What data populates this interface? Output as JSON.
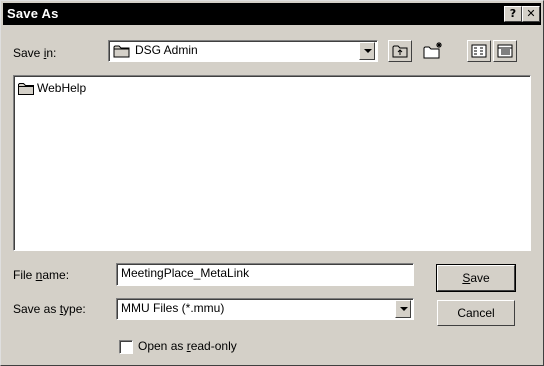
{
  "window": {
    "title": "Save As",
    "help_glyph": "?",
    "close_glyph": "✕"
  },
  "save_in": {
    "label_pre": "Save ",
    "label_hotkey": "i",
    "label_post": "n:",
    "value": "DSG Admin"
  },
  "toolbar": {
    "icons": [
      "up-one-level-icon",
      "create-new-folder-icon",
      "list-view-icon",
      "details-view-icon"
    ]
  },
  "file_list": {
    "items": [
      {
        "name": "WebHelp",
        "icon": "folder-icon"
      }
    ]
  },
  "file_name": {
    "label_pre": "File ",
    "label_hotkey": "n",
    "label_post": "ame:",
    "value": "MeetingPlace_MetaLink"
  },
  "save_as_type": {
    "label_pre": "Save as ",
    "label_hotkey": "t",
    "label_post": "ype:",
    "value": "MMU Files (*.mmu)"
  },
  "read_only": {
    "label_pre": "Open as ",
    "label_hotkey": "r",
    "label_post": "ead-only",
    "checked": false
  },
  "buttons": {
    "save_hotkey": "S",
    "save_rest": "ave",
    "cancel": "Cancel"
  },
  "colors": {
    "face": "#d4d0c8",
    "titlebar": "#000000",
    "folder": "#d4d0c8"
  }
}
